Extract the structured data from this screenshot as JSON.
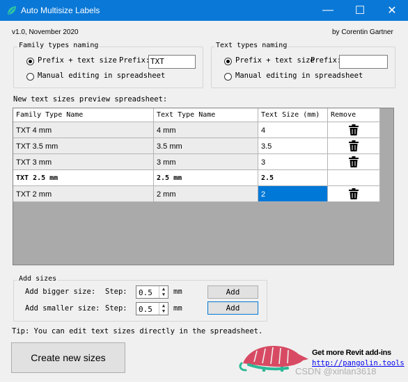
{
  "window": {
    "title": "Auto Multisize Labels",
    "minimize": "—",
    "maximize": "☐",
    "close": "✕"
  },
  "version": "v1.0, November 2020",
  "author": "by Corentin Gartner",
  "family_group": {
    "legend": "Family types naming",
    "option1": "Prefix + text size",
    "prefix_label": "Prefix:",
    "prefix_value": "TXT",
    "option2": "Manual editing in spreadsheet"
  },
  "text_group": {
    "legend": "Text types naming",
    "option1": "Prefix + text size",
    "prefix_label": "Prefix:",
    "prefix_value": "",
    "option2": "Manual editing in spreadsheet"
  },
  "preview_label": "New text sizes preview spreadsheet:",
  "grid": {
    "headers": [
      "Family Type Name",
      "Text Type Name",
      "Text Size (mm)",
      "Remove"
    ],
    "rows": [
      {
        "family": "TXT 4 mm",
        "text": "4 mm",
        "size": "4"
      },
      {
        "family": "TXT 3.5 mm",
        "text": "3.5 mm",
        "size": "3.5"
      },
      {
        "family": "TXT 3 mm",
        "text": "3 mm",
        "size": "3"
      },
      {
        "family": "TXT 2.5 mm",
        "text": "2.5 mm",
        "size": "2.5"
      },
      {
        "family": "TXT 2 mm",
        "text": "2 mm",
        "size": "2"
      }
    ]
  },
  "add_sizes": {
    "legend": "Add sizes",
    "bigger_label": "Add bigger size:",
    "smaller_label": "Add smaller size:",
    "step_label": "Step:",
    "bigger_step": "0.5",
    "smaller_step": "0.5",
    "unit": "mm",
    "add_label": "Add"
  },
  "tip": "Tip: You can edit text sizes directly in the spreadsheet.",
  "create_button": "Create new sizes",
  "promo": {
    "heading": "Get more Revit add-ins",
    "link": "http://pangolin.tools"
  },
  "watermark": "CSDN @xinlan3618",
  "colors": {
    "titlebar": "#0a78d7",
    "selection": "#0078d7",
    "logo": "#d84a63"
  }
}
